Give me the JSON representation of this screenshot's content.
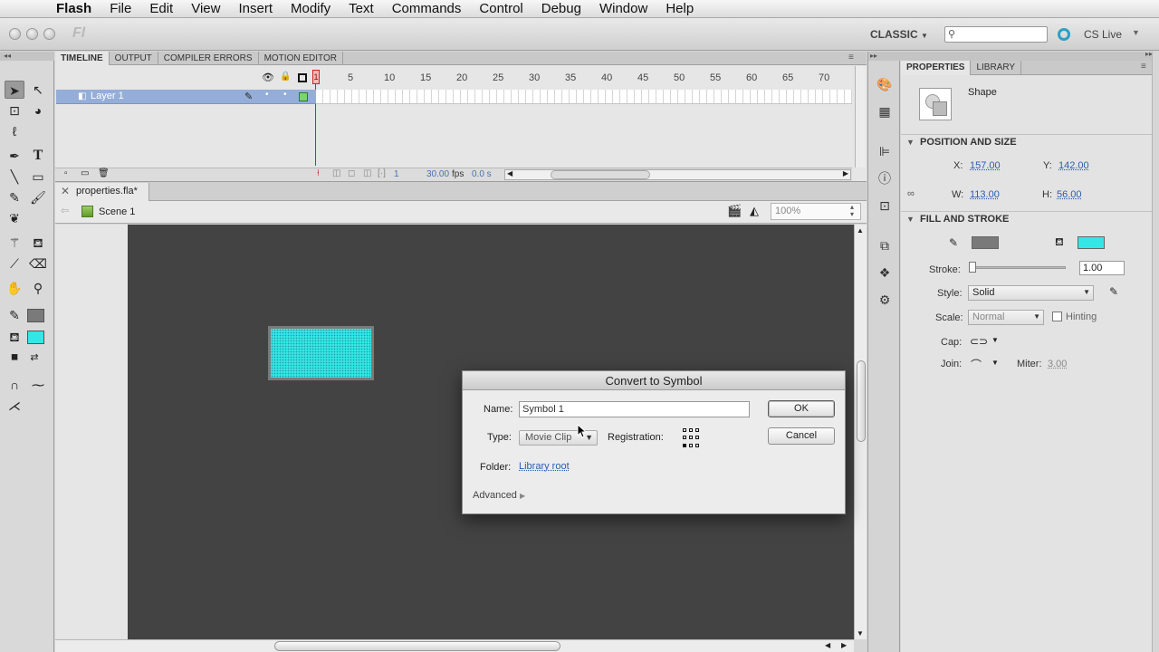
{
  "menubar": {
    "app": "Flash",
    "items": [
      "File",
      "Edit",
      "View",
      "Insert",
      "Modify",
      "Text",
      "Commands",
      "Control",
      "Debug",
      "Window",
      "Help"
    ]
  },
  "appbar": {
    "logo": "Fl",
    "workspace": "CLASSIC",
    "search_placeholder": "",
    "cslive": "CS Live"
  },
  "timeline": {
    "tabs": [
      "TIMELINE",
      "OUTPUT",
      "COMPILER ERRORS",
      "MOTION EDITOR"
    ],
    "ticks": [
      "1",
      "5",
      "10",
      "15",
      "20",
      "25",
      "30",
      "35",
      "40",
      "45",
      "50",
      "55",
      "60",
      "65",
      "70"
    ],
    "layer_name": "Layer 1",
    "current_frame": "1",
    "fps": "30.00",
    "fps_label": "fps",
    "time": "0.0 s"
  },
  "document": {
    "tab_title": "properties.fla*",
    "scene": "Scene 1",
    "zoom": "100%"
  },
  "dialog": {
    "title": "Convert to Symbol",
    "name_label": "Name:",
    "name_value": "Symbol 1",
    "type_label": "Type:",
    "type_value": "Movie Clip",
    "registration_label": "Registration:",
    "folder_label": "Folder:",
    "folder_value": "Library root",
    "advanced": "Advanced",
    "ok": "OK",
    "cancel": "Cancel"
  },
  "properties": {
    "tabs": [
      "PROPERTIES",
      "LIBRARY"
    ],
    "object_type": "Shape",
    "position_size": {
      "title": "POSITION AND SIZE",
      "x_label": "X:",
      "x": "157.00",
      "y_label": "Y:",
      "y": "142.00",
      "w_label": "W:",
      "w": "113.00",
      "h_label": "H:",
      "h": "56.00"
    },
    "fill_stroke": {
      "title": "FILL AND STROKE",
      "stroke_color": "#7a7a7a",
      "fill_color": "#35e6e6",
      "stroke_label": "Stroke:",
      "stroke_value": "1.00",
      "style_label": "Style:",
      "style_value": "Solid",
      "scale_label": "Scale:",
      "scale_value": "Normal",
      "hinting_label": "Hinting",
      "cap_label": "Cap:",
      "join_label": "Join:",
      "miter_label": "Miter:",
      "miter_value": "3.00"
    }
  }
}
